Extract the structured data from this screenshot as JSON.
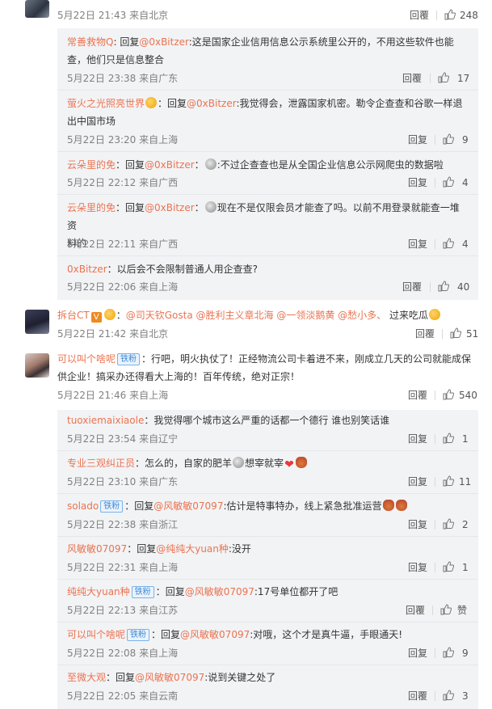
{
  "top_comment": {
    "time": "5月22日 21:43 来自北京",
    "reply_label": "回覆",
    "likes": "248"
  },
  "replies_1": [
    {
      "user": "常善救物Q",
      "sep": ": ",
      "prefix": "回复",
      "mention": "@0xBitzer",
      "text": ":这是国家企业信用信息公示系统里公开的，不用这些软件也能",
      "text2": "查，他们只是信息整合",
      "time": "5月22日 23:38 来自广东",
      "reply_label": "回覆",
      "likes": "17"
    },
    {
      "user": "萤火之光照亮世界",
      "sep": "：",
      "prefix": "回复",
      "mention": "@0xBitzer",
      "text": ":我觉得会，泄露国家机密。勒令企查查和谷歌一样退",
      "text2": "出中国市场",
      "time": "5月22日 23:20 来自上海",
      "reply_label": "回复",
      "likes": "9"
    },
    {
      "user": "云朵里的免",
      "sep": "：",
      "prefix": "回复",
      "mention": "@0xBitzer",
      "text": ":不过企查查也是从全国企业信息公示网爬虫的数据啦",
      "time": "5月22日 22:12 来自广西",
      "reply_label": "回复",
      "likes": "4"
    },
    {
      "user": "云朵里的免",
      "sep": "：",
      "prefix": "回复",
      "mention": "@0xBitzer",
      "text": "现在不是仅限会员才能查了吗。以前不用登录就能查一堆资",
      "text2": "料的",
      "time": "5月22日 22:11 来自广西",
      "reply_label": "回复",
      "likes": "4"
    },
    {
      "user": "0xBitzer",
      "sep": "：",
      "text": "以后会不会限制普通人用企查查?",
      "time": "5月22日 22:06 来自上海",
      "reply_label": "回覆",
      "likes": "40"
    }
  ],
  "comment_2": {
    "user": "拆台CT",
    "mentions": "@司天钦Gosta @胜利主义章北海 @一领淡鹅黄 @愁小多、",
    "text": "过来吃瓜",
    "time": "5月22日 21:42 来自北京",
    "reply_label": "回覆",
    "likes": "51"
  },
  "comment_3": {
    "user": "可以叫个啥呢",
    "badge": "铁粉",
    "text": "：行吧，明火执仗了！正经物流公司卡着进不来，刚成立几天的公司就能成保",
    "text2": "供企业！搞采办还得看大上海的！百年传统，绝对正宗！",
    "time": "5月22日 21:46 来自上海",
    "reply_label": "回覆",
    "likes": "540"
  },
  "replies_2": [
    {
      "user": "tuoxiemaixiaole",
      "sep": "：",
      "text": "我觉得哪个城市这么严重的话都一个德行 谁也别笑话谁",
      "time": "5月22日 23:54 来自辽宁",
      "reply_label": "回复",
      "likes": "1"
    },
    {
      "user": "专业三观纠正员",
      "sep": "：",
      "text": "怎么的，自家的肥羊",
      "text_b": "想宰就宰",
      "time": "5月22日 23:10 来自广东",
      "reply_label": "回复",
      "likes": "11"
    },
    {
      "user": "solado",
      "badge": "铁粉",
      "sep": "：",
      "prefix": "回复",
      "mention": "@风敏敏07097",
      "text": ":估计是特事特办，线上紧急批准运营",
      "time": "5月22日 22:38 来自浙江",
      "reply_label": "回复",
      "likes": "2"
    },
    {
      "user": "风敏敏07097",
      "sep": "：",
      "prefix": "回复",
      "mention": "@纯纯大yuan种",
      "text": ":没开",
      "time": "5月22日 22:31 来自上海",
      "reply_label": "回复",
      "likes": "1"
    },
    {
      "user": "纯纯大yuan种",
      "badge": "铁粉",
      "sep": "：",
      "prefix": "回复",
      "mention": "@风敏敏07097",
      "text": ":17号单位都开了吧",
      "time": "5月22日 22:13 来自江苏",
      "reply_label": "回覆",
      "likes": "赞"
    },
    {
      "user": "可以叫个啥呢",
      "badge": "铁粉",
      "sep": "：",
      "prefix": "回复",
      "mention": "@风敏敏07097",
      "text": ":对哦，这个才是真牛逼，手眼通天!",
      "time": "5月22日 22:08 来自上海",
      "reply_label": "回复",
      "likes": "9"
    },
    {
      "user": "至微大观",
      "sep": "：",
      "prefix": "回复",
      "mention": "@风敏敏07097",
      "text": ":说到关键之处了",
      "time": "5月22日 22:05 来自云南",
      "reply_label": "回覆",
      "likes": "3"
    }
  ],
  "colors": {
    "accent": "#eb7350",
    "panel": "#f2f3f5",
    "muted": "#808080"
  },
  "icons": {
    "like": "thumbs-up-icon",
    "emoji": "emoji-icon",
    "badge": "fan-badge"
  }
}
